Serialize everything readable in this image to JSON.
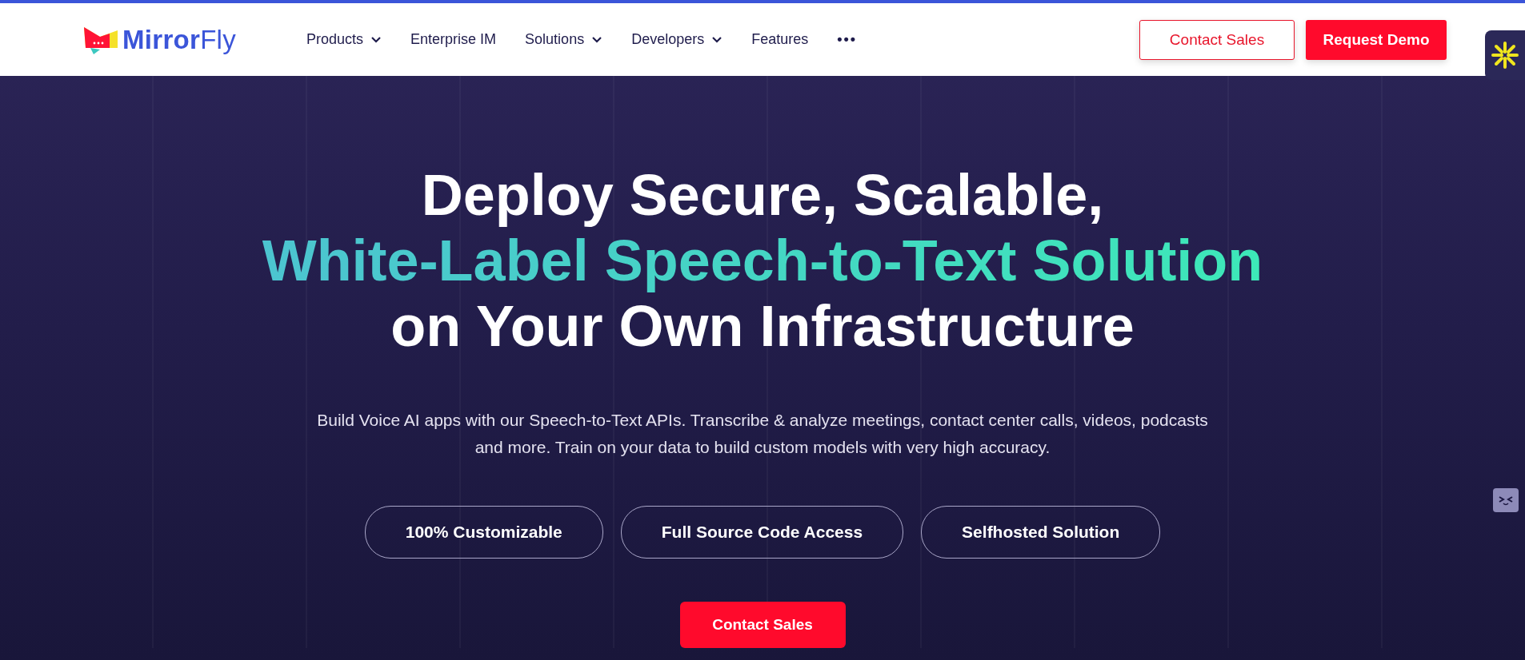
{
  "header": {
    "logo": "**Mirror**Fly",
    "nav": [
      {
        "label": "Products",
        "dropdown": true
      },
      {
        "label": "Enterprise IM",
        "dropdown": false
      },
      {
        "label": "Solutions",
        "dropdown": true
      },
      {
        "label": "Developers",
        "dropdown": true
      },
      {
        "label": "Features",
        "dropdown": false
      }
    ],
    "more": "•••",
    "buttons": [
      {
        "label": "Contact Sales",
        "kind": "outline"
      },
      {
        "label": "Request Demo",
        "kind": "solid"
      }
    ]
  },
  "hero": {
    "title_lines": [
      {
        "text": "Deploy Secure, Scalable,",
        "highlight": false
      },
      {
        "text": "White-Label Speech-to-Text Solution",
        "highlight": true
      },
      {
        "text": "on Your Own Infrastructure",
        "highlight": false
      }
    ],
    "description": "Build Voice AI apps with our Speech-to-Text APIs. Transcribe & analyze meetings, contact center calls, videos, podcasts and more. Train on your data to build custom models with very high accuracy.",
    "features": [
      "100% Customizable",
      "Full Source Code Access",
      "Selfhosted Solution"
    ],
    "cta": "Contact Sales"
  }
}
